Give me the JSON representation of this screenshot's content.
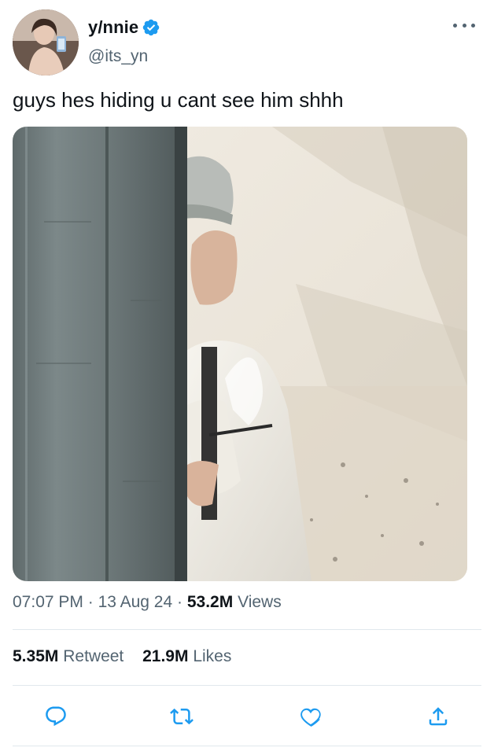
{
  "tweet": {
    "author_name": "y/nnie",
    "author_handle": "@its_yn",
    "verified": true,
    "text": "guys hes hiding u cant see him shhh",
    "time": "07:07 PM",
    "date": "13 Aug 24",
    "separator": "·",
    "views_count": "53.2M",
    "views_label": "Views",
    "retweets_count": "5.35M",
    "retweets_label": "Retweet",
    "likes_count": "21.9M",
    "likes_label": "Likes"
  },
  "icons": {
    "more": "more-dots-icon",
    "reply": "reply-icon",
    "retweet": "retweet-icon",
    "like": "heart-icon",
    "share": "share-icon",
    "verified": "verified-badge-icon"
  },
  "colors": {
    "text": "#0f1419",
    "secondary": "#536471",
    "verified": "#1d9bf0",
    "divider": "#e1e8ed"
  }
}
